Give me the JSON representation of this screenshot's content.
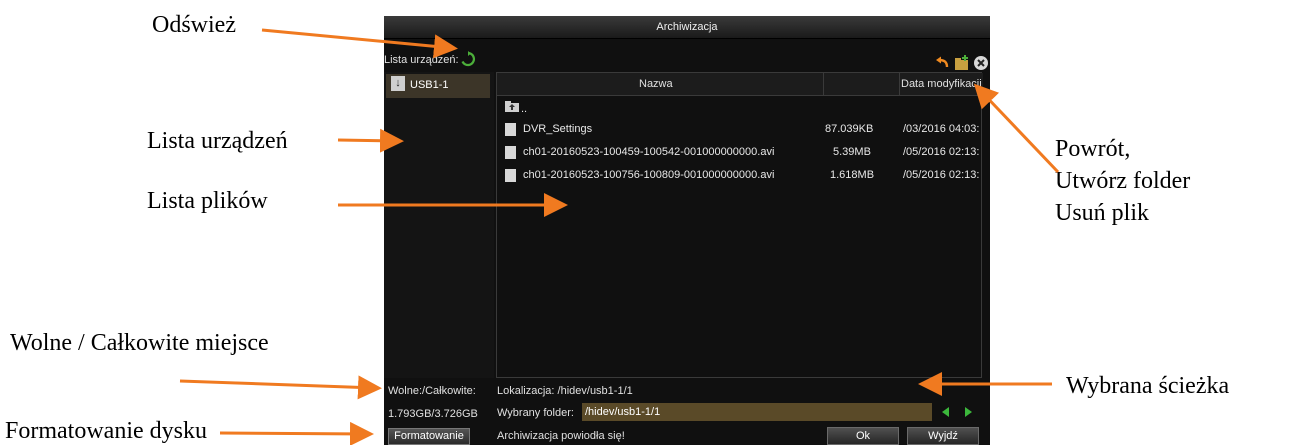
{
  "annotations": {
    "refresh": "Odśwież",
    "device_list": "Lista urządzeń",
    "file_list": "Lista plików",
    "back_create_delete": [
      "Powrót,",
      "Utwórz folder",
      "Usuń plik"
    ],
    "free_total": "Wolne / Całkowite miejsce",
    "format": "Formatowanie dysku",
    "selected_path": "Wybrana ścieżka"
  },
  "dialog": {
    "title": "Archiwizacja",
    "device_list_label": "Lista urządzeń:",
    "devices": [
      {
        "label": "USB1-1"
      }
    ],
    "columns": {
      "name": "Nazwa",
      "size": "",
      "date": "Data modyfikacji"
    },
    "parent_dir": "..",
    "files": [
      {
        "name": "DVR_Settings",
        "size": "87.039KB",
        "date": "/03/2016 04:03:"
      },
      {
        "name": "ch01-20160523-100459-100542-001000000000.avi",
        "size": "5.39MB",
        "date": "/05/2016 02:13:"
      },
      {
        "name": "ch01-20160523-100756-100809-001000000000.avi",
        "size": "1.618MB",
        "date": "/05/2016 02:13:"
      }
    ],
    "free_total_label": "Wolne:/Całkowite:",
    "free_total_value": "1.793GB/3.726GB",
    "format_button": "Formatowanie",
    "location": "Lokalizacja: /hidev/usb1-1/1",
    "selected_folder_label": "Wybrany folder:",
    "selected_folder_value": "/hidev/usb1-1/1",
    "status": "Archiwizacja powiodła się!",
    "ok_button": "Ok",
    "exit_button": "Wyjdź"
  },
  "icons": {
    "refresh": "refresh-icon",
    "back": "back-icon",
    "new_folder": "new-folder-icon",
    "delete": "delete-icon",
    "usb": "usb-icon",
    "file": "file-icon",
    "up_folder": "up-folder-icon",
    "prev": "prev-arrow-icon",
    "next": "next-arrow-icon"
  },
  "colors": {
    "annotation_arrow": "#f07a20",
    "dialog_bg": "#101010",
    "selected_device": "#3c3528",
    "folder_input": "#5a4a28",
    "refresh_green": "#4caf3a",
    "back_orange": "#f08a20",
    "nav_green": "#3cb83c"
  }
}
